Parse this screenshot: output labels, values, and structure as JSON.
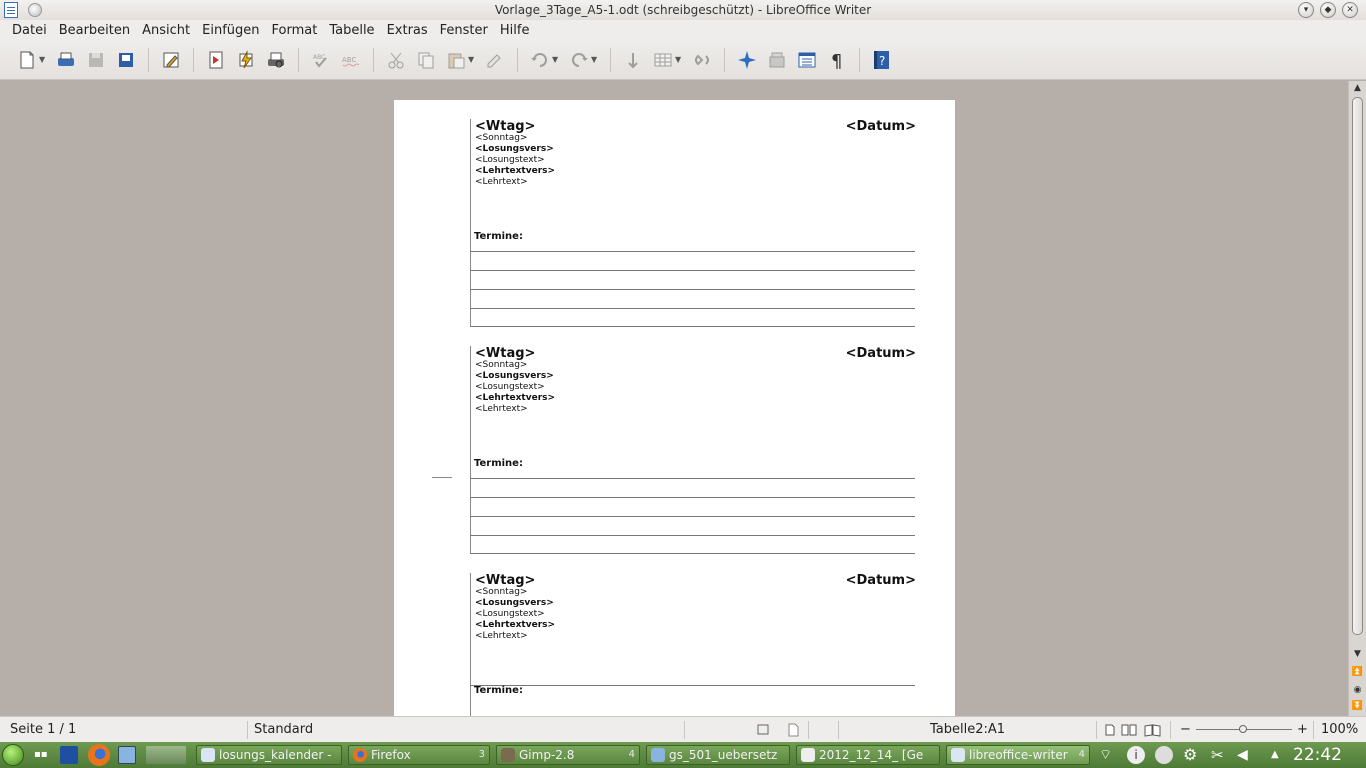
{
  "window": {
    "title": "Vorlage_3Tage_A5-1.odt (schreibgeschützt) - LibreOffice Writer"
  },
  "menubar": {
    "items": [
      "Datei",
      "Bearbeiten",
      "Ansicht",
      "Einfügen",
      "Format",
      "Tabelle",
      "Extras",
      "Fenster",
      "Hilfe"
    ]
  },
  "toolbar": {
    "buttons": [
      "new-document",
      "print",
      "save",
      "save-as",
      "edit-mode",
      "export-pdf",
      "autopilot",
      "print-preview",
      "spellcheck",
      "auto-spellcheck",
      "cut",
      "copy",
      "paste",
      "format-paint",
      "undo",
      "redo",
      "insert-table",
      "table",
      "hyperlink",
      "navigator",
      "gallery",
      "data-sources",
      "formatting-marks",
      "help"
    ]
  },
  "document": {
    "blocks": [
      {
        "wtag": "<Wtag>",
        "datum": "<Datum>",
        "lines": [
          "<Sonntag>",
          "<Losungsvers>",
          "<Losungstext>",
          "<Lehrtextvers>",
          "<Lehrtext>"
        ],
        "termine": "Termine:"
      },
      {
        "wtag": "<Wtag>",
        "datum": "<Datum>",
        "lines": [
          "<Sonntag>",
          "<Losungsvers>",
          "<Losungstext>",
          "<Lehrtextvers>",
          "<Lehrtext>"
        ],
        "termine": "Termine:"
      },
      {
        "wtag": "<Wtag>",
        "datum": "<Datum>",
        "lines": [
          "<Sonntag>",
          "<Losungsvers>",
          "<Losungstext>",
          "<Lehrtextvers>",
          "<Lehrtext>"
        ],
        "termine": "Termine:"
      }
    ]
  },
  "statusbar": {
    "page": "Seite 1 / 1",
    "style": "Standard",
    "cell": "Tabelle2:A1",
    "zoom": "100%",
    "zoom_minus": "−",
    "zoom_plus": "+"
  },
  "taskbar": {
    "tasks": [
      {
        "label": "losungs_kalender -",
        "num": ""
      },
      {
        "label": "Firefox",
        "num": "3"
      },
      {
        "label": "Gimp-2.8",
        "num": "4"
      },
      {
        "label": "gs_501_uebersetz",
        "num": ""
      },
      {
        "label": "2012_12_14_ [Ge",
        "num": ""
      },
      {
        "label": "libreoffice-writer",
        "num": "4"
      }
    ],
    "clock": "22:42"
  },
  "colors": {
    "taskbar": "#5a8640",
    "docarea": "#b5aea9",
    "page": "#ffffff",
    "accent_blue": "#3a6fb5"
  }
}
